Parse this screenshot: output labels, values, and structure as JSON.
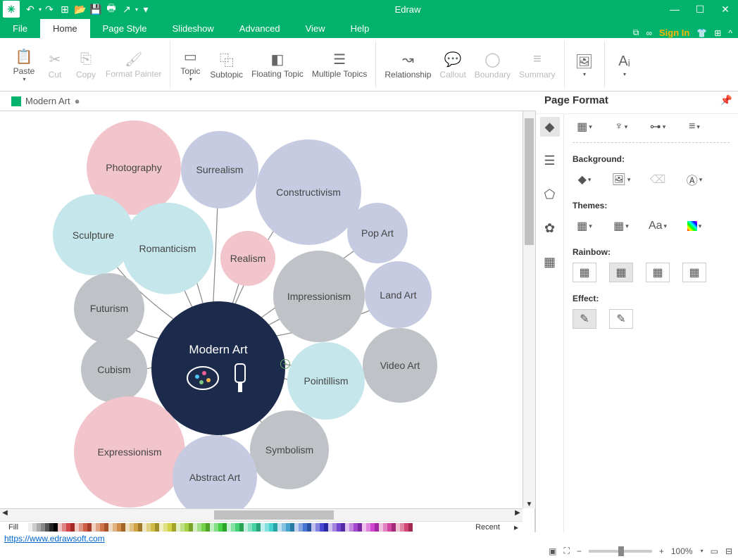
{
  "title": "Edraw",
  "menus": {
    "file": "File",
    "home": "Home",
    "page_style": "Page Style",
    "slideshow": "Slideshow",
    "advanced": "Advanced",
    "view": "View",
    "help": "Help"
  },
  "signin": "Sign In",
  "ribbon": {
    "paste": "Paste",
    "cut": "Cut",
    "copy": "Copy",
    "fmt": "Format Painter",
    "topic": "Topic",
    "subtopic": "Subtopic",
    "float": "Floating Topic",
    "multi": "Multiple Topics",
    "rel": "Relationship",
    "callout": "Callout",
    "boundary": "Boundary",
    "summary": "Summary"
  },
  "doc_tab": "Modern Art",
  "bubbles": {
    "center": "Modern Art",
    "photography": "Photography",
    "surrealism": "Surrealism",
    "constructivism": "Constructivism",
    "sculpture": "Sculpture",
    "romanticism": "Romanticism",
    "realism": "Realism",
    "popart": "Pop Art",
    "futurism": "Futurism",
    "impressionism": "Impressionism",
    "landart": "Land Art",
    "cubism": "Cubism",
    "videoart": "Video Art",
    "pointillism": "Pointillism",
    "expressionism": "Expressionism",
    "symbolism": "Symbolism",
    "abstract": "Abstract Art"
  },
  "palette": {
    "fill": "Fill",
    "recent": "Recent"
  },
  "panel": {
    "title": "Page Format",
    "bg": "Background:",
    "themes": "Themes:",
    "rainbow": "Rainbow:",
    "effect": "Effect:"
  },
  "footer": {
    "link": "https://www.edrawsoft.com",
    "zoom": "100%"
  }
}
